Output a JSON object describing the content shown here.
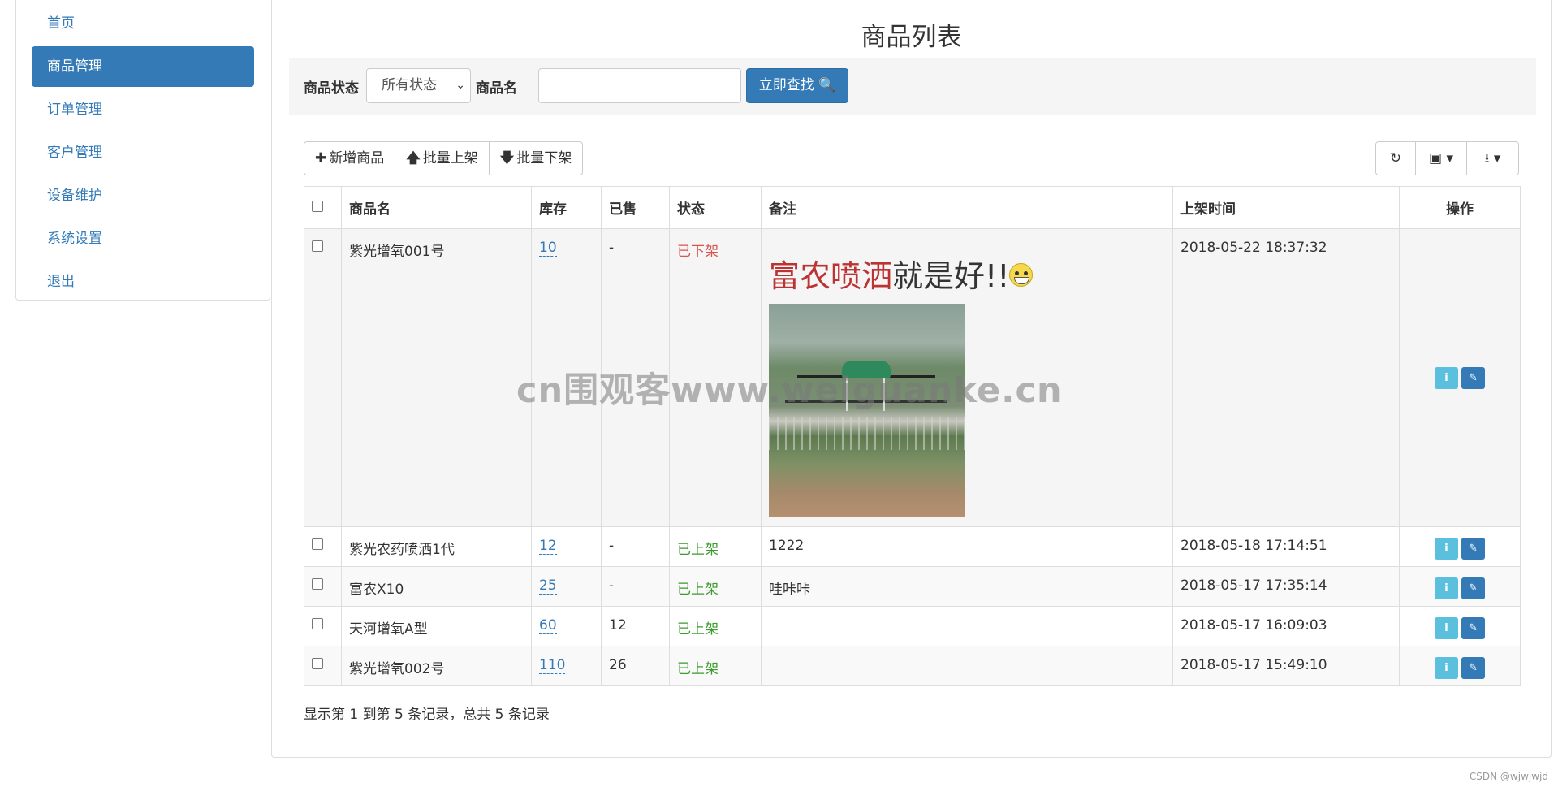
{
  "sidebar": {
    "items": [
      {
        "label": "首页"
      },
      {
        "label": "商品管理"
      },
      {
        "label": "订单管理"
      },
      {
        "label": "客户管理"
      },
      {
        "label": "设备维护"
      },
      {
        "label": "系统设置"
      },
      {
        "label": "退出"
      }
    ]
  },
  "main": {
    "title": "商品列表",
    "search": {
      "status_label": "商品状态",
      "status_value": "所有状态",
      "name_label": "商品名",
      "name_value": "",
      "search_button": "立即查找"
    },
    "toolbar": {
      "add": "新增商品",
      "batch_on": "批量上架",
      "batch_off": "批量下架"
    },
    "table": {
      "headers": {
        "name": "商品名",
        "stock": "库存",
        "sold": "已售",
        "status": "状态",
        "note": "备注",
        "time": "上架时间",
        "ops": "操作"
      },
      "rows": [
        {
          "name": "紫光增氧001号",
          "stock": "10",
          "sold": "-",
          "status": "已下架",
          "note_red": "富农喷洒",
          "note_dark": "就是好!!",
          "time": "2018-05-22 18:37:32"
        },
        {
          "name": "紫光农药喷洒1代",
          "stock": "12",
          "sold": "-",
          "status": "已上架",
          "note": "1222",
          "time": "2018-05-18 17:14:51"
        },
        {
          "name": "富农X10",
          "stock": "25",
          "sold": "-",
          "status": "已上架",
          "note": "哇咔咔",
          "time": "2018-05-17 17:35:14"
        },
        {
          "name": "天河增氧A型",
          "stock": "60",
          "sold": "12",
          "status": "已上架",
          "note": "",
          "time": "2018-05-17 16:09:03"
        },
        {
          "name": "紫光增氧002号",
          "stock": "110",
          "sold": "26",
          "status": "已上架",
          "note": "",
          "time": "2018-05-17 15:49:10"
        }
      ]
    },
    "pagination_info": "显示第 1 到第 5 条记录，总共 5 条记录"
  },
  "watermark": "cn围观客www.weiguanke.cn",
  "credit": "CSDN @wjwjwjd",
  "colors": {
    "primary": "#337ab7",
    "info": "#5bc0de",
    "off": "#d9534f",
    "on": "#3c9a2f"
  }
}
